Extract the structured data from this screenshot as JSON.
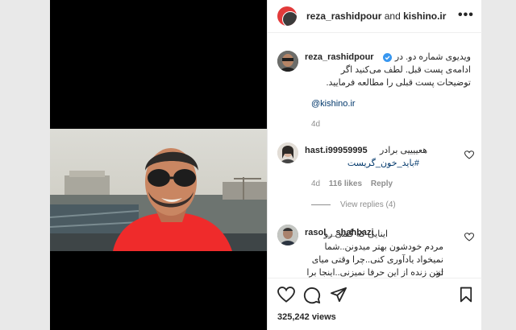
{
  "post_header": {
    "owner": "reza_rashidpour",
    "joiner": "and",
    "collaborator": "kishino.ir",
    "more_label": "•••"
  },
  "caption": {
    "username": "reza_rashidpour",
    "line1": "ویدیوی شماره دو. در",
    "line2": "ادامه‌ی پست قبل. لطف می‌کنید اگر",
    "line3": "توضیحات پست قبلی را مطالعه فرمایید.",
    "mention": "@kishino.ir",
    "time": "4d"
  },
  "comments": [
    {
      "username": "hast.i99959995",
      "text_line1": "هعییییی برادر",
      "text_line2": "#باید_خون_گریست",
      "time": "4d",
      "likes": "116 likes",
      "reply": "Reply",
      "view_replies": "View replies (4)"
    },
    {
      "username": "rasol__shahbazi",
      "lines": [
        "اینایی که گفتی رو",
        "مردم خودشون بهتر میدونن..شما",
        "نمیخواد یادآوری کنی..چرا وقتی میای تو",
        "انتن زنده از این حرفا نمیزنی..اینجا برا جم"
      ]
    }
  ],
  "views": "325,242 views",
  "colors": {
    "accent_link": "#00376b",
    "verified": "#3897f0",
    "shirt": "#ef2b2b",
    "avatar_ring": "#e23a3a"
  },
  "icons": [
    "heart-icon",
    "comment-icon",
    "share-icon",
    "bookmark-icon",
    "more-icon",
    "verified-icon"
  ]
}
